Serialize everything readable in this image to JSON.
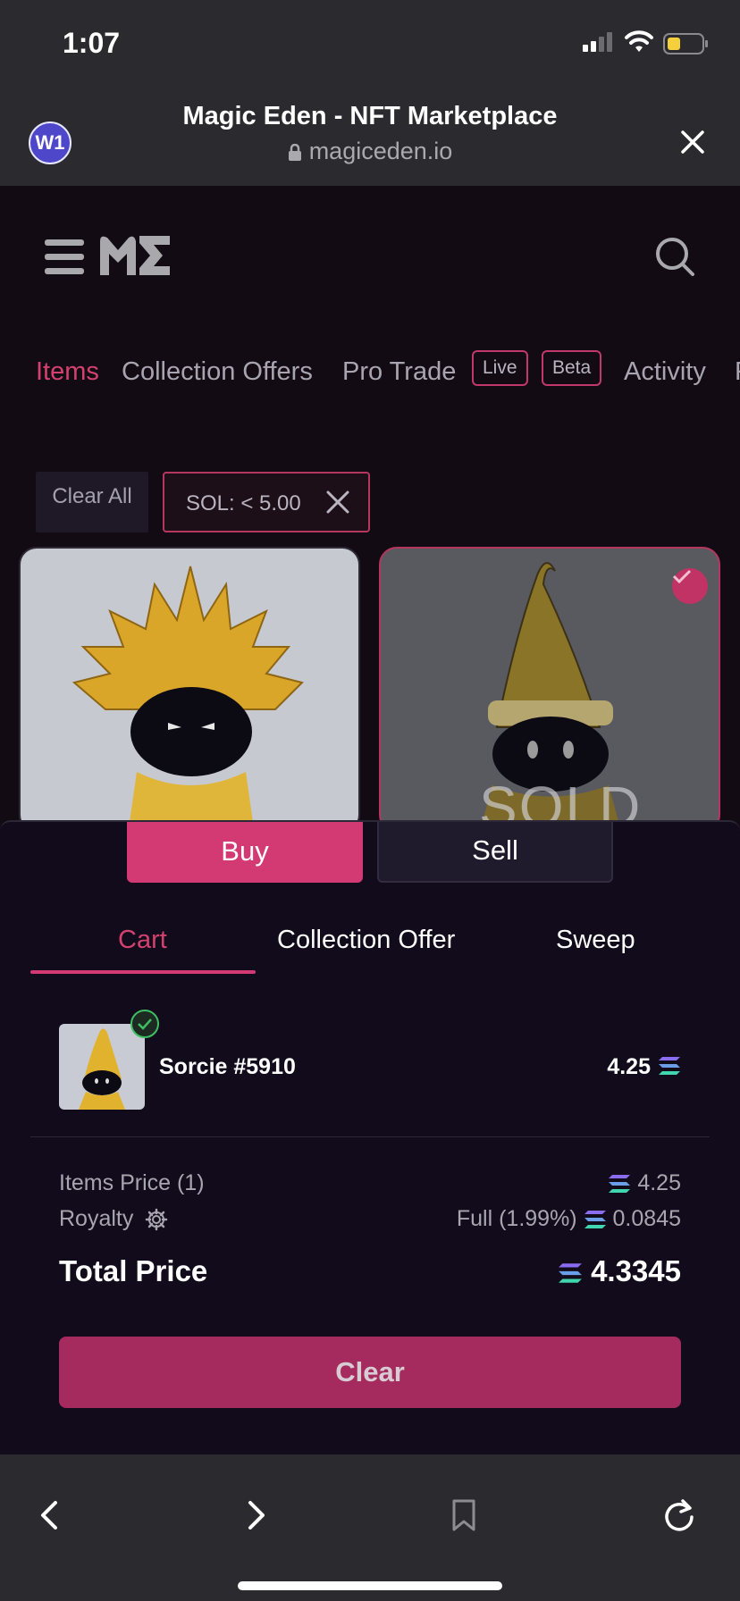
{
  "status_bar": {
    "time": "1:07"
  },
  "browser": {
    "tab_badge": "W1",
    "title": "Magic Eden - NFT Marketplace",
    "url": "magiceden.io"
  },
  "tabs": [
    {
      "label": "Items"
    },
    {
      "label": "Collection Offers"
    },
    {
      "label": "Pro Trade"
    },
    {
      "label": "Live"
    },
    {
      "label": "Beta"
    },
    {
      "label": "Activity"
    },
    {
      "label": "F"
    }
  ],
  "filters": {
    "clear_all": "Clear All",
    "chip": "SOL: < 5.00"
  },
  "cards": {
    "sold_label": "SOLD"
  },
  "sheet": {
    "buy": "Buy",
    "sell": "Sell",
    "tabs": [
      "Cart",
      "Collection Offer",
      "Sweep"
    ],
    "item": {
      "name": "Sorcie #5910",
      "price": "4.25"
    },
    "items_price_label": "Items Price (1)",
    "items_price_value": "4.25",
    "royalty_label": "Royalty",
    "royalty_mode": "Full (1.99%)",
    "royalty_value": "0.0845",
    "total_label": "Total Price",
    "total_value": "4.3345",
    "clear_button": "Clear"
  },
  "colors": {
    "accent": "#d33a74",
    "background": "#120b14",
    "browser_chrome": "#2b2b2f"
  }
}
